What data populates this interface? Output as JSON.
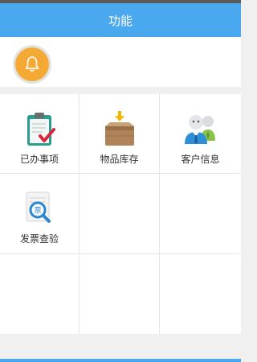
{
  "header": {
    "title": "功能"
  },
  "notification": {
    "icon": "bell-icon",
    "accent_color": "#f4a935"
  },
  "grid": {
    "items": [
      {
        "label": "已办事项",
        "icon": "clipboard-check-icon"
      },
      {
        "label": "物品库存",
        "icon": "box-icon"
      },
      {
        "label": "客户信息",
        "icon": "users-icon"
      },
      {
        "label": "发票查验",
        "icon": "invoice-search-icon"
      }
    ]
  },
  "colors": {
    "header": "#4aa8ee",
    "text": "#333333"
  }
}
